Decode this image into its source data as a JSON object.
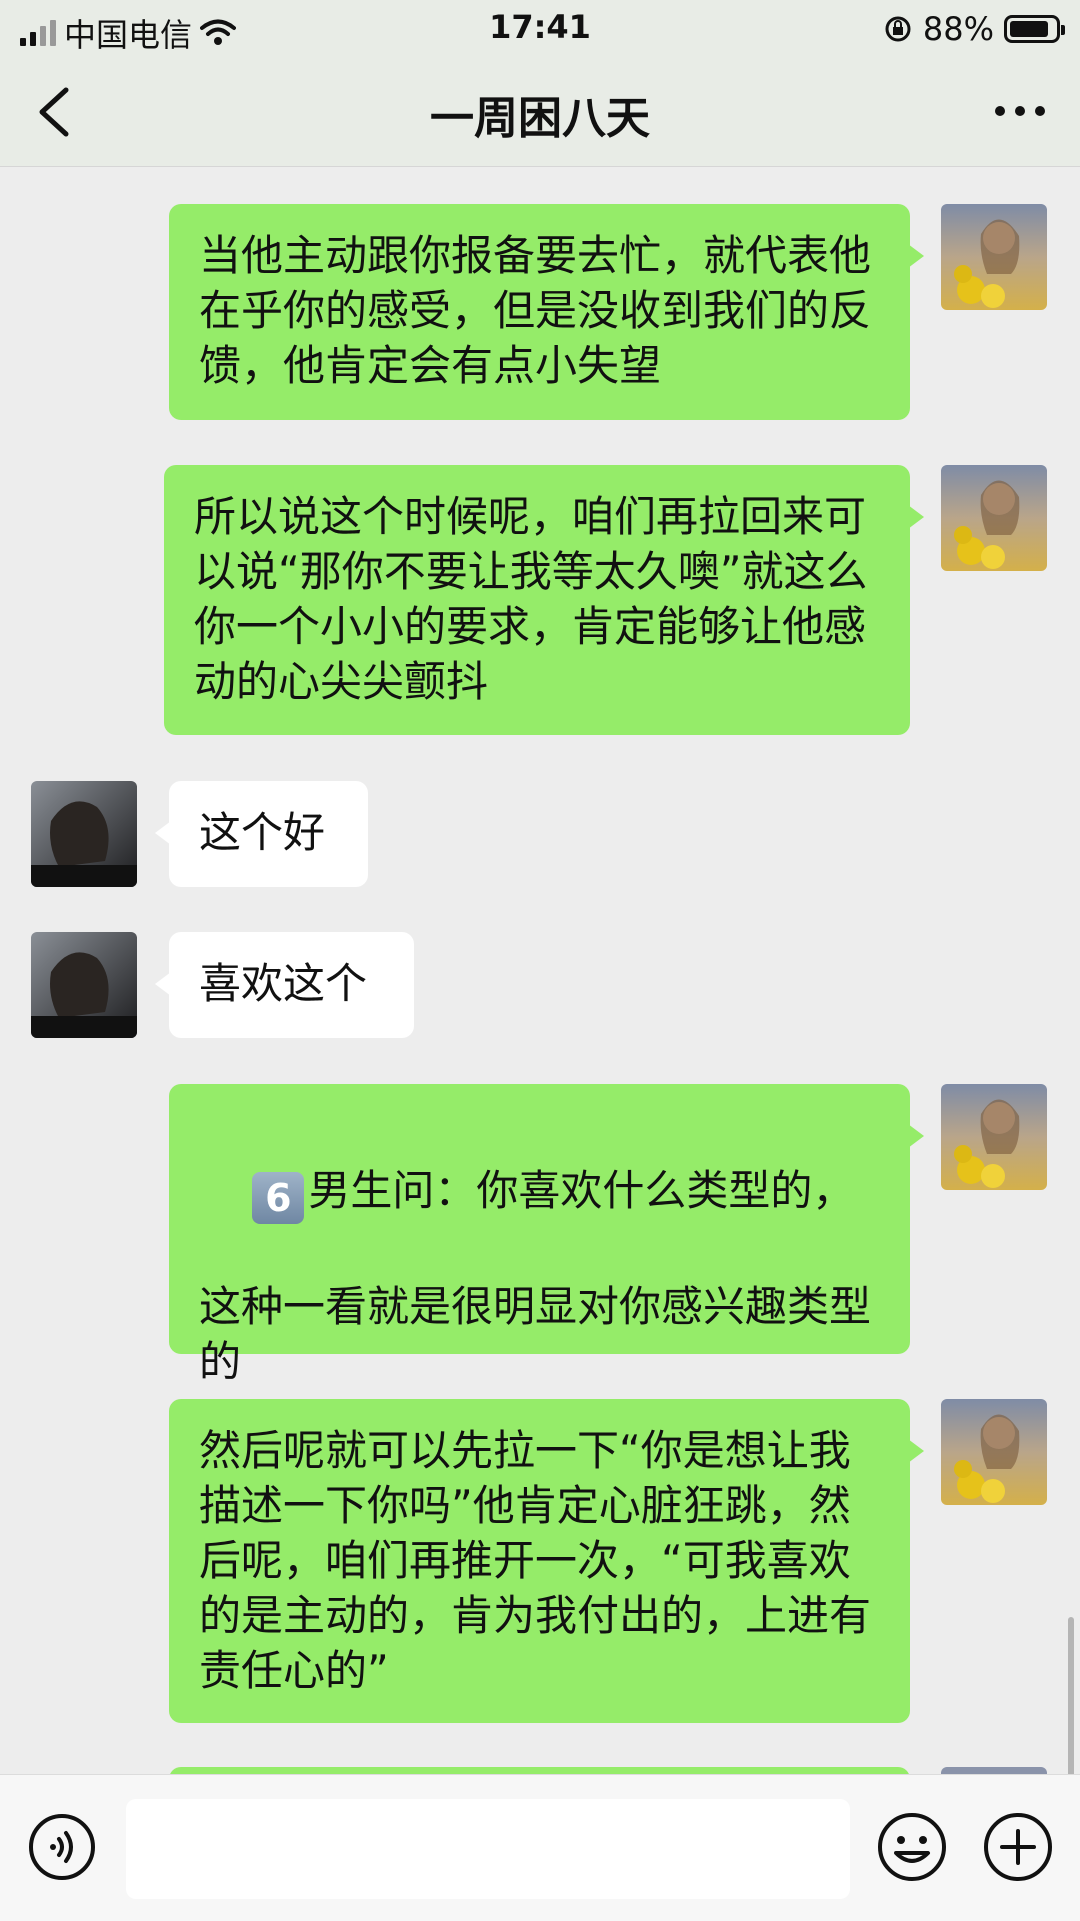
{
  "status_bar": {
    "carrier": "中国电信",
    "time": "17:41",
    "battery_percent": "88%",
    "battery_level": 0.88,
    "icons": [
      "signal-icon",
      "wifi-icon",
      "orientation-lock-icon",
      "battery-icon"
    ]
  },
  "nav": {
    "title": "一周困八天",
    "icons": [
      "back-icon",
      "more-icon"
    ]
  },
  "messages": [
    {
      "from": "me",
      "text": "当他主动跟你报备要去忙，就代表他在乎你的感受，但是没收到我们的反馈，他肯定会有点小失望"
    },
    {
      "from": "me",
      "text": "所以说这个时候呢，咱们再拉回来可以说“那你不要让我等太久噢”就这么你一个小小的要求，肯定能够让他感动的心尖尖颤抖"
    },
    {
      "from": "other",
      "text": "这个好"
    },
    {
      "from": "other",
      "text": "喜欢这个"
    },
    {
      "from": "me",
      "keycap": "6",
      "text": "男生问：你喜欢什么类型的，\n\n这种一看就是很明显对你感兴趣类型的"
    },
    {
      "from": "me",
      "text": "然后呢就可以先拉一下“你是想让我描述一下你吗”他肯定心脏狂跳，然后呢，咱们再推开一次，“可我喜欢的是主动的，肯为我付出的，上进有责任心的”"
    }
  ],
  "input_bar": {
    "placeholder": "",
    "icons": [
      "voice-icon",
      "emoji-icon",
      "plus-icon"
    ]
  },
  "colors": {
    "my_bubble": "#95ec69",
    "other_bubble": "#ffffff",
    "background": "#ededed",
    "header": "#e8ece6"
  }
}
